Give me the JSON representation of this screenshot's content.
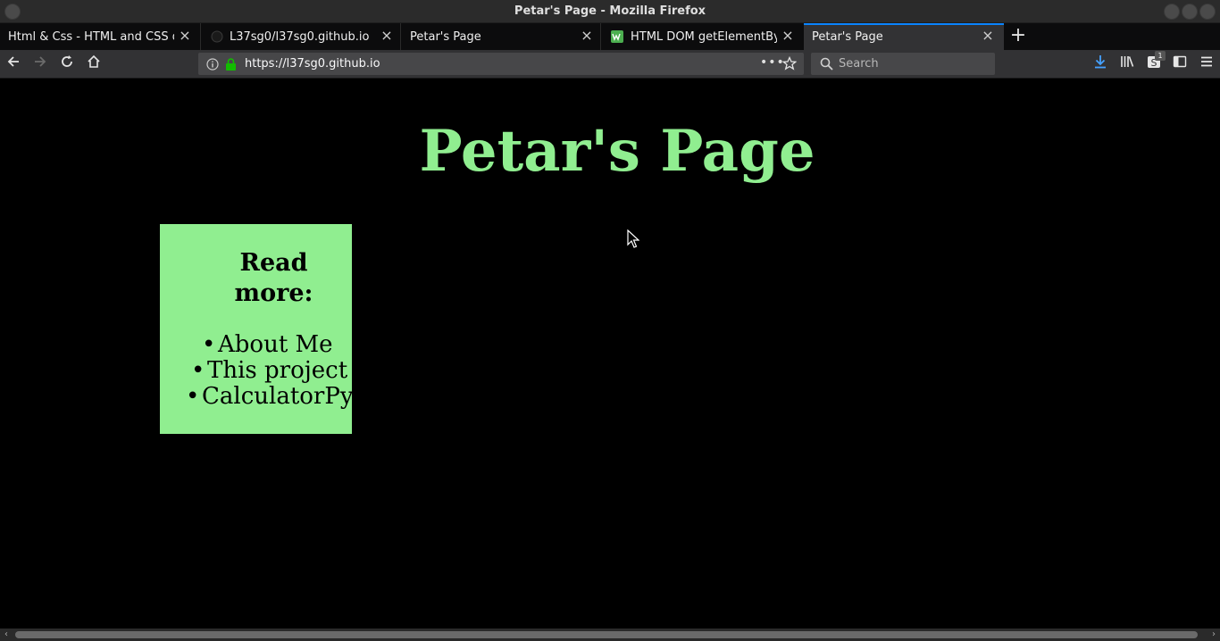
{
  "window": {
    "title": "Petar's Page - Mozilla Firefox"
  },
  "tabs": [
    {
      "label": "Html & Css - HTML and CSS desi",
      "icon": "none"
    },
    {
      "label": "L37sg0/l37sg0.github.io",
      "icon": "github-icon"
    },
    {
      "label": "Petar's Page",
      "icon": "none"
    },
    {
      "label": "HTML DOM getElementById",
      "icon": "w3schools-icon"
    },
    {
      "label": "Petar's Page",
      "icon": "none",
      "active": true
    }
  ],
  "navbar": {
    "url": "https://l37sg0.github.io",
    "search_placeholder": "Search",
    "sync_badge": "1"
  },
  "page": {
    "heading": "Petar's Page",
    "box_heading": "Read more:",
    "links": [
      "About Me",
      "This project",
      "CalculatorPy"
    ]
  },
  "colors": {
    "accent_green": "#90ee90",
    "page_bg": "#000000",
    "active_tab_indicator": "#0a84ff"
  }
}
